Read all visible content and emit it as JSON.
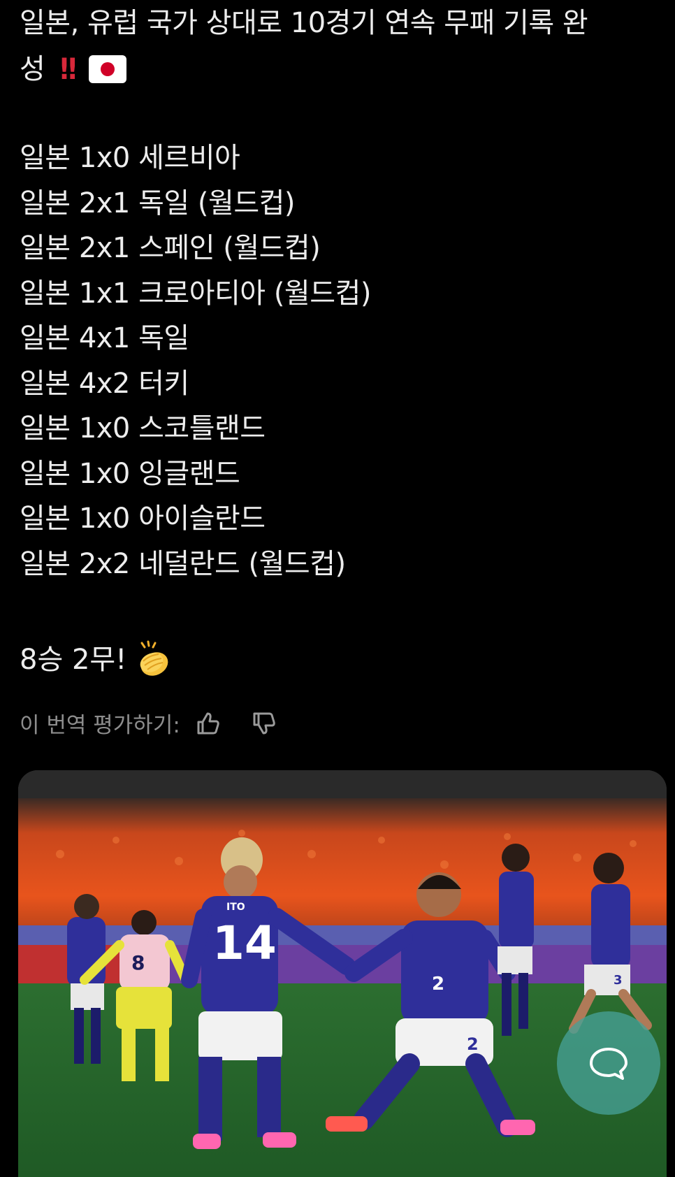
{
  "post": {
    "headline_line1": "일본, 유럽 국가 상대로 10경기 연속 무패 기록 완",
    "headline_line2": "성",
    "emphasis_icon": "double-exclamation-icon",
    "flag_icon": "japan-flag-icon",
    "results": [
      "일본 1x0 세르비아",
      "일본 2x1 독일 (월드컵)",
      "일본 2x1 스페인 (월드컵)",
      "일본 1x1 크로아티아 (월드컵)",
      "일본 4x1 독일",
      "일본 4x2 터키",
      "일본 1x0 스코틀랜드",
      "일본 1x0 잉글랜드",
      "일본 1x0 아이슬란드",
      "일본 2x2 네덜란드 (월드컵)"
    ],
    "summary": "8승 2무!",
    "summary_icon": "clapping-hands-icon"
  },
  "translation_rating": {
    "label": "이 번역 평가하기:",
    "thumbs_up_icon": "thumbs-up-icon",
    "thumbs_down_icon": "thumbs-down-icon"
  },
  "media": {
    "jersey_number_front": "14",
    "jersey_name": "ITO",
    "jersey_number_2": "2",
    "jersey_number_3": "3"
  },
  "floating_button": {
    "icon": "chat-bubble-icon"
  },
  "colors": {
    "background": "#000000",
    "text": "#ededed",
    "muted_text": "#8d8d8d",
    "exclamation": "#d8283a",
    "flag_red": "#d00027",
    "fab": "#46a096",
    "japan_kit": "#2f2f9a",
    "crowd_orange": "#e8541c",
    "pitch_green": "#2f7a35"
  }
}
